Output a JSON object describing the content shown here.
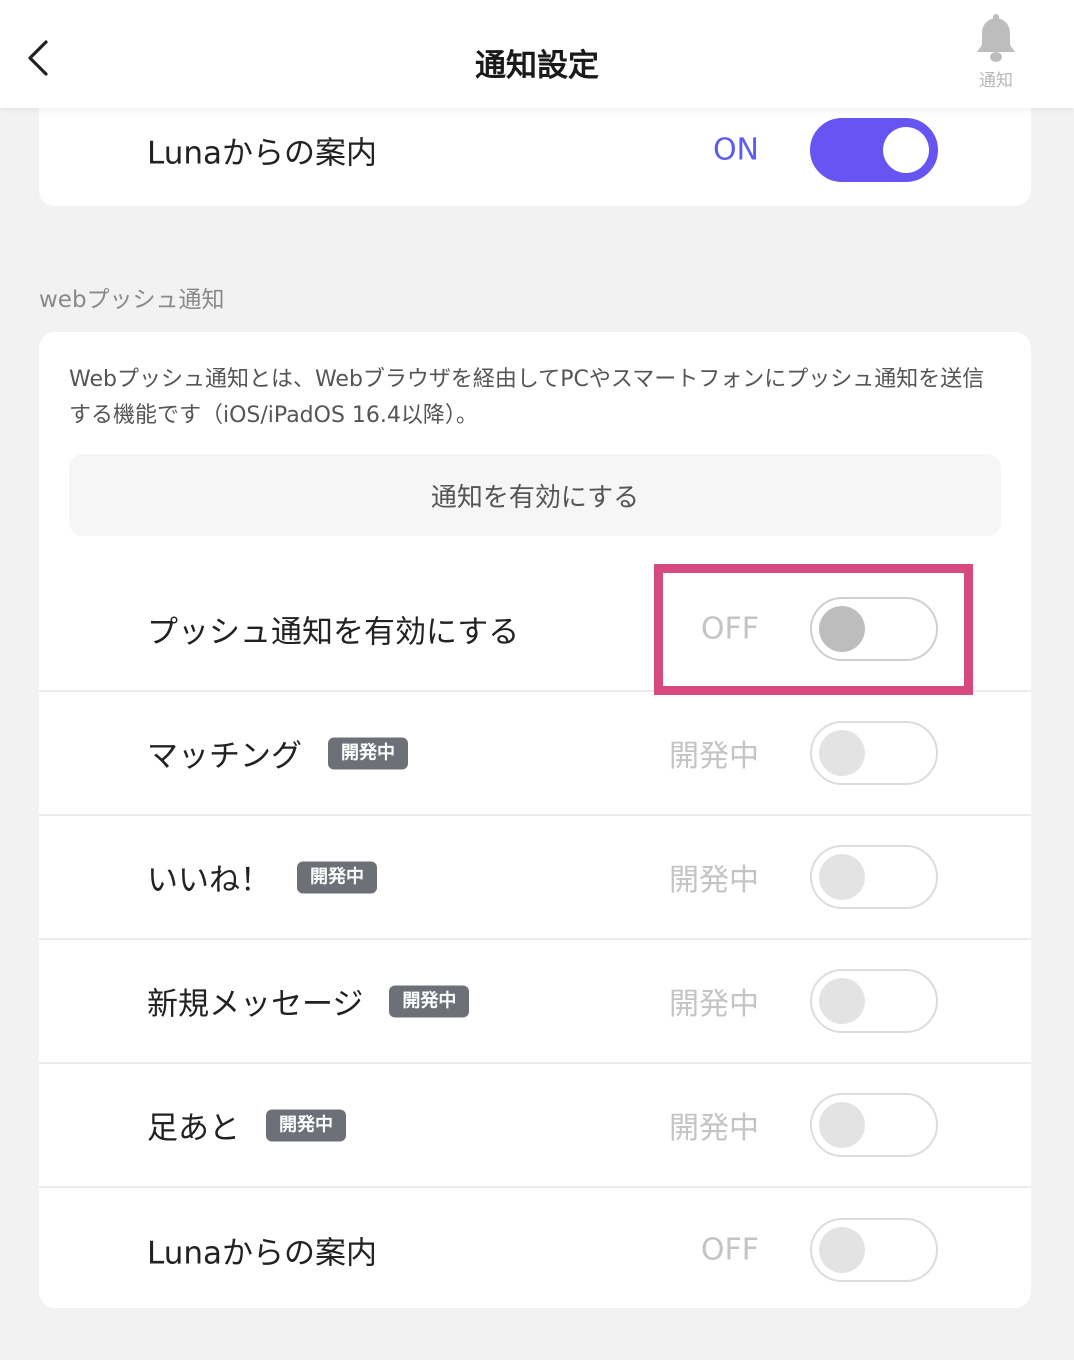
{
  "header": {
    "title": "通知設定",
    "bell_label": "通知"
  },
  "top_card": {
    "label": "Lunaからの案内",
    "status": "ON"
  },
  "web_push": {
    "section_title": "webプッシュ通知",
    "description": "Webプッシュ通知とは、Webブラウザを経由してPCやスマートフォンにプッシュ通知を送信する機能です（iOS/iPadOS 16.4以降）。",
    "enable_button": "通知を有効にする",
    "rows": [
      {
        "label": "プッシュ通知を有効にする",
        "badge": "",
        "status": "OFF"
      },
      {
        "label": "マッチング",
        "badge": "開発中",
        "status": "開発中"
      },
      {
        "label": "いいね！",
        "badge": "開発中",
        "status": "開発中"
      },
      {
        "label": "新規メッセージ",
        "badge": "開発中",
        "status": "開発中"
      },
      {
        "label": "足あと",
        "badge": "開発中",
        "status": "開発中"
      },
      {
        "label": "Lunaからの案内",
        "badge": "",
        "status": "OFF"
      }
    ]
  },
  "colors": {
    "accent": "#6655f2",
    "on_text": "#5c5cf0",
    "highlight": "#d64a7f",
    "badge": "#6d7177"
  },
  "icons": {
    "back": "chevron-left-icon",
    "bell": "bell-icon"
  }
}
